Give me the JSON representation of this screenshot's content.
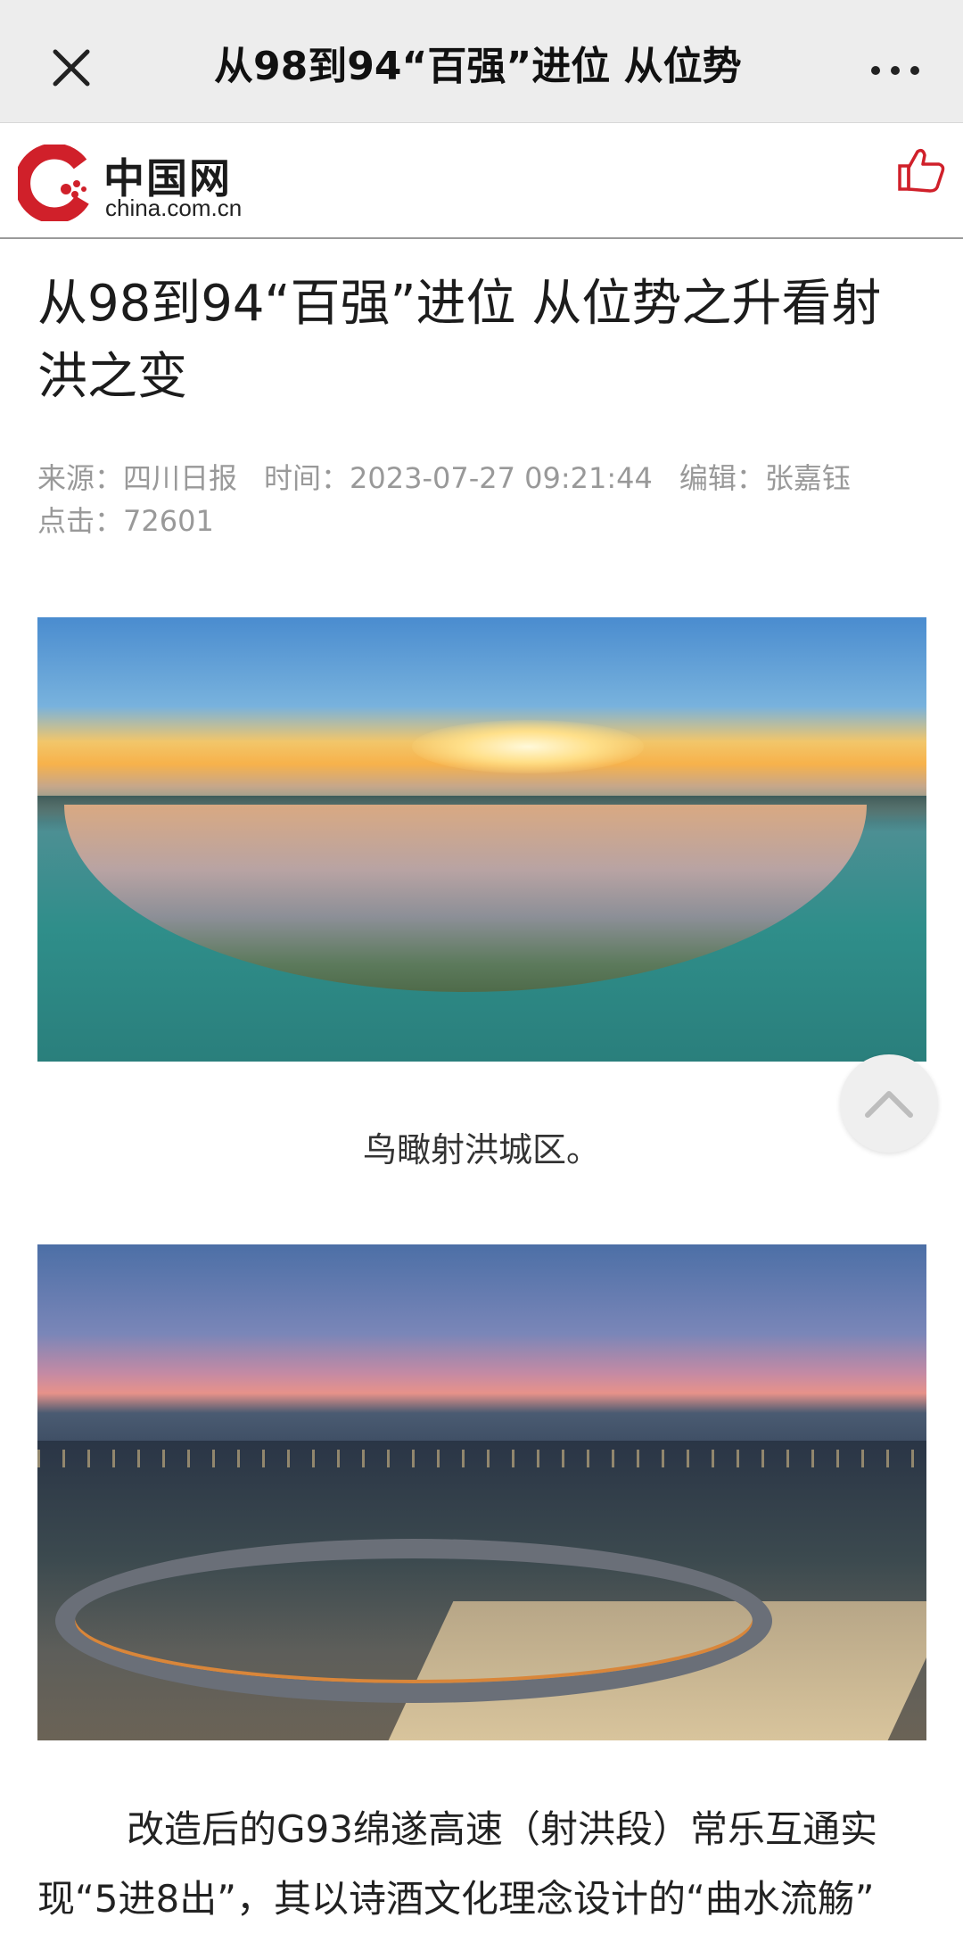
{
  "topbar": {
    "title": "从98到94“百强”进位 从位势"
  },
  "site": {
    "logo_cn": "中国网",
    "logo_en": "china.com.cn",
    "brand_color": "#d0202a"
  },
  "article": {
    "title": "从98到94“百强”进位 从位势之升看射洪之变",
    "meta": {
      "source": "来源：四川日报",
      "time": "时间：2023-07-27 09:21:44",
      "editor": "编辑：张嘉钰",
      "clicks": "点击：72601"
    },
    "image1_caption": "鸟瞰射洪城区。",
    "paragraph": "改造后的G93绵遂高速（射洪段）常乐互通实现“5进8出”，其以诗酒文化理念设计的“曲水流觞”"
  },
  "icons": {
    "close": "close-icon",
    "more": "more-icon",
    "like": "thumbs-up-icon",
    "back_to_top": "chevron-up-icon"
  }
}
